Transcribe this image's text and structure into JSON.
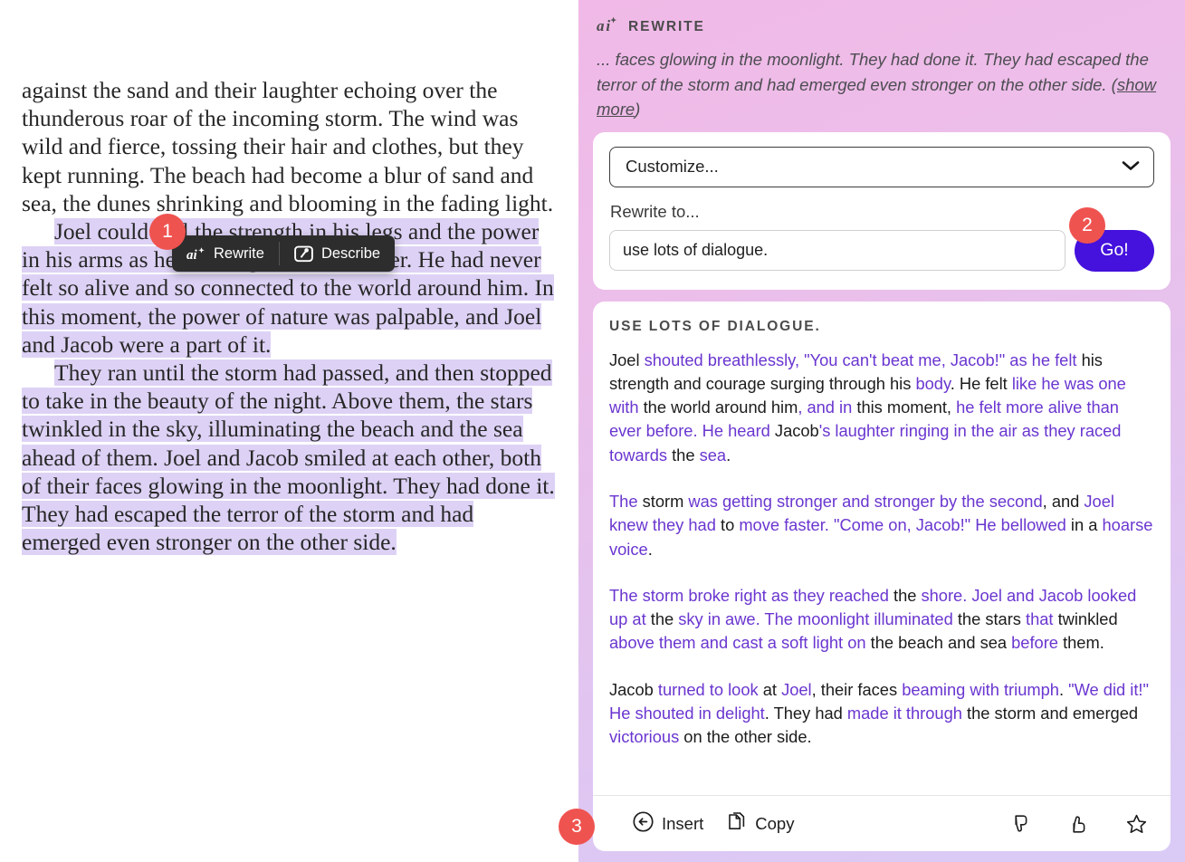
{
  "document": {
    "paragraphs": [
      {
        "id": "p1",
        "selected": false,
        "indent": false,
        "text": "against the sand and their laughter echoing over the thunderous roar of the incoming storm. The wind was wild and fierce, tossing their hair and clothes, but they kept running. The beach had become a blur of sand and sea, the dunes shrinking and blooming in the fading light."
      },
      {
        "id": "p2",
        "selected": true,
        "indent": true,
        "text": "Joel could feel the strength in his legs and the power in his arms as he raced against his brother. He had never felt so alive and so connected to the world around him. In this moment, the power of nature was palpable, and Joel and Jacob were a part of it."
      },
      {
        "id": "p3",
        "selected": true,
        "indent": true,
        "text": "They ran until the storm had passed, and then stopped to take in the beauty of the night. Above them, the stars twinkled in the sky, illuminating the beach and the sea ahead of them. Joel and Jacob smiled at each other, both of their faces glowing in the moonlight. They had done it. They had escaped the terror of the storm and had emerged even stronger on the other side."
      }
    ],
    "selection_color": "#ddd2f5"
  },
  "floating_toolbar": {
    "rewrite_label": "Rewrite",
    "rewrite_icon": "ai-sparkle-icon",
    "describe_label": "Describe",
    "describe_icon": "magic-wand-image-icon",
    "background": "#2d2d2d"
  },
  "callouts": [
    {
      "number": "1",
      "target": "floating-toolbar"
    },
    {
      "number": "2",
      "target": "go-button"
    },
    {
      "number": "3",
      "target": "insert-button"
    }
  ],
  "callout_color": "#ef5350",
  "panel": {
    "header": {
      "icon": "ai-sparkle-icon",
      "title": "REWRITE",
      "snippet_text": "... faces glowing in the moonlight. They had done it. They had escaped the terror of the storm and had emerged even stronger on the other side. (",
      "show_more_label": "show more",
      "snippet_tail": ")"
    },
    "controls": {
      "customize_value": "Customize...",
      "customize_icon": "chevron-down-icon",
      "rewrite_label": "Rewrite to...",
      "rewrite_input_value": "use lots of dialogue.",
      "rewrite_input_placeholder": "Rewrite to...",
      "go_label": "Go!",
      "go_color": "#4411dd"
    },
    "result": {
      "title": "USE LOTS OF DIALOGUE.",
      "diff_color": "#6a36d0",
      "paragraphs": [
        [
          {
            "t": "Joel ",
            "d": false
          },
          {
            "t": "shouted breathlessly, \"You can't beat me, Jacob!\" as he felt ",
            "d": true
          },
          {
            "t": "his strength and courage surging through ",
            "d": false
          },
          {
            "t": "his ",
            "d": false
          },
          {
            "t": "body",
            "d": true
          },
          {
            "t": ". He felt ",
            "d": false
          },
          {
            "t": "like he was one with ",
            "d": true
          },
          {
            "t": "the world around him",
            "d": false
          },
          {
            "t": ", and in ",
            "d": true
          },
          {
            "t": "this moment, ",
            "d": false
          },
          {
            "t": "he felt more alive than ever before. He heard ",
            "d": true
          },
          {
            "t": "Jacob",
            "d": false
          },
          {
            "t": "'s laughter ringing in the air as they raced towards ",
            "d": true
          },
          {
            "t": "the ",
            "d": false
          },
          {
            "t": "sea",
            "d": true
          },
          {
            "t": ".",
            "d": false
          }
        ],
        [
          {
            "t": "The ",
            "d": true
          },
          {
            "t": "storm ",
            "d": false
          },
          {
            "t": "was getting stronger and stronger by the second",
            "d": true
          },
          {
            "t": ", and ",
            "d": false
          },
          {
            "t": "Joel knew they had ",
            "d": true
          },
          {
            "t": "to ",
            "d": false
          },
          {
            "t": "move faster. \"Come on, Jacob!\" He bellowed ",
            "d": true
          },
          {
            "t": "in a ",
            "d": false
          },
          {
            "t": "hoarse voice",
            "d": true
          },
          {
            "t": ".",
            "d": false
          }
        ],
        [
          {
            "t": "The storm broke right as they reached ",
            "d": true
          },
          {
            "t": "the ",
            "d": false
          },
          {
            "t": "shore. Joel and Jacob looked up at ",
            "d": true
          },
          {
            "t": "the ",
            "d": false
          },
          {
            "t": "sky in awe. The moonlight illuminated ",
            "d": true
          },
          {
            "t": "the stars ",
            "d": false
          },
          {
            "t": "that ",
            "d": true
          },
          {
            "t": "twinkled ",
            "d": false
          },
          {
            "t": "above them and cast a soft light on ",
            "d": true
          },
          {
            "t": "the beach and sea ",
            "d": false
          },
          {
            "t": "before ",
            "d": true
          },
          {
            "t": "them.",
            "d": false
          }
        ],
        [
          {
            "t": "Jacob ",
            "d": false
          },
          {
            "t": "turned to look ",
            "d": true
          },
          {
            "t": "at ",
            "d": false
          },
          {
            "t": "Joel",
            "d": true
          },
          {
            "t": ", their faces ",
            "d": false
          },
          {
            "t": "beaming with triumph",
            "d": true
          },
          {
            "t": ". ",
            "d": false
          },
          {
            "t": "\"We did it!\" He shouted in delight",
            "d": true
          },
          {
            "t": ". They had ",
            "d": false
          },
          {
            "t": "made it through ",
            "d": true
          },
          {
            "t": "the storm and emerged ",
            "d": false
          },
          {
            "t": "victorious ",
            "d": true
          },
          {
            "t": "on the other side.",
            "d": false
          }
        ]
      ]
    },
    "actions": {
      "insert_label": "Insert",
      "insert_icon": "arrow-left-circle-icon",
      "copy_label": "Copy",
      "copy_icon": "copy-documents-icon",
      "feedback": [
        {
          "icon": "thumbs-down-icon"
        },
        {
          "icon": "thumbs-up-icon"
        },
        {
          "icon": "star-outline-icon"
        }
      ]
    }
  }
}
